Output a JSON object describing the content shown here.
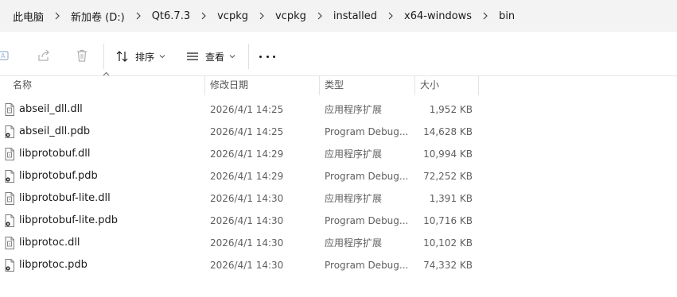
{
  "breadcrumb": {
    "items": [
      "此电脑",
      "新加卷 (D:)",
      "Qt6.7.3",
      "vcpkg",
      "vcpkg",
      "installed",
      "x64-windows",
      "bin"
    ]
  },
  "toolbar": {
    "sort_label": "排序",
    "view_label": "查看",
    "icons": [
      "rename-icon",
      "share-icon",
      "delete-icon",
      "sort-icon",
      "view-icon",
      "more-icon"
    ]
  },
  "columns": {
    "name": "名称",
    "date": "修改日期",
    "type": "类型",
    "size": "大小"
  },
  "files": [
    {
      "name": "abseil_dll.dll",
      "date": "2026/4/1 14:25",
      "type": "应用程序扩展",
      "size": "1,952 KB",
      "icon": "dll-file-icon"
    },
    {
      "name": "abseil_dll.pdb",
      "date": "2026/4/1 14:25",
      "type": "Program Debug...",
      "size": "14,628 KB",
      "icon": "pdb-file-icon"
    },
    {
      "name": "libprotobuf.dll",
      "date": "2026/4/1 14:29",
      "type": "应用程序扩展",
      "size": "10,994 KB",
      "icon": "dll-file-icon"
    },
    {
      "name": "libprotobuf.pdb",
      "date": "2026/4/1 14:29",
      "type": "Program Debug...",
      "size": "72,252 KB",
      "icon": "pdb-file-icon"
    },
    {
      "name": "libprotobuf-lite.dll",
      "date": "2026/4/1 14:30",
      "type": "应用程序扩展",
      "size": "1,391 KB",
      "icon": "dll-file-icon"
    },
    {
      "name": "libprotobuf-lite.pdb",
      "date": "2026/4/1 14:30",
      "type": "Program Debug...",
      "size": "10,716 KB",
      "icon": "pdb-file-icon"
    },
    {
      "name": "libprotoc.dll",
      "date": "2026/4/1 14:30",
      "type": "应用程序扩展",
      "size": "10,102 KB",
      "icon": "dll-file-icon"
    },
    {
      "name": "libprotoc.pdb",
      "date": "2026/4/1 14:30",
      "type": "Program Debug...",
      "size": "74,332 KB",
      "icon": "pdb-file-icon"
    }
  ],
  "colors": {
    "breadcrumb_bg": "#f3f3f3",
    "text": "#1a1a1a",
    "muted": "#5f5f5f"
  }
}
